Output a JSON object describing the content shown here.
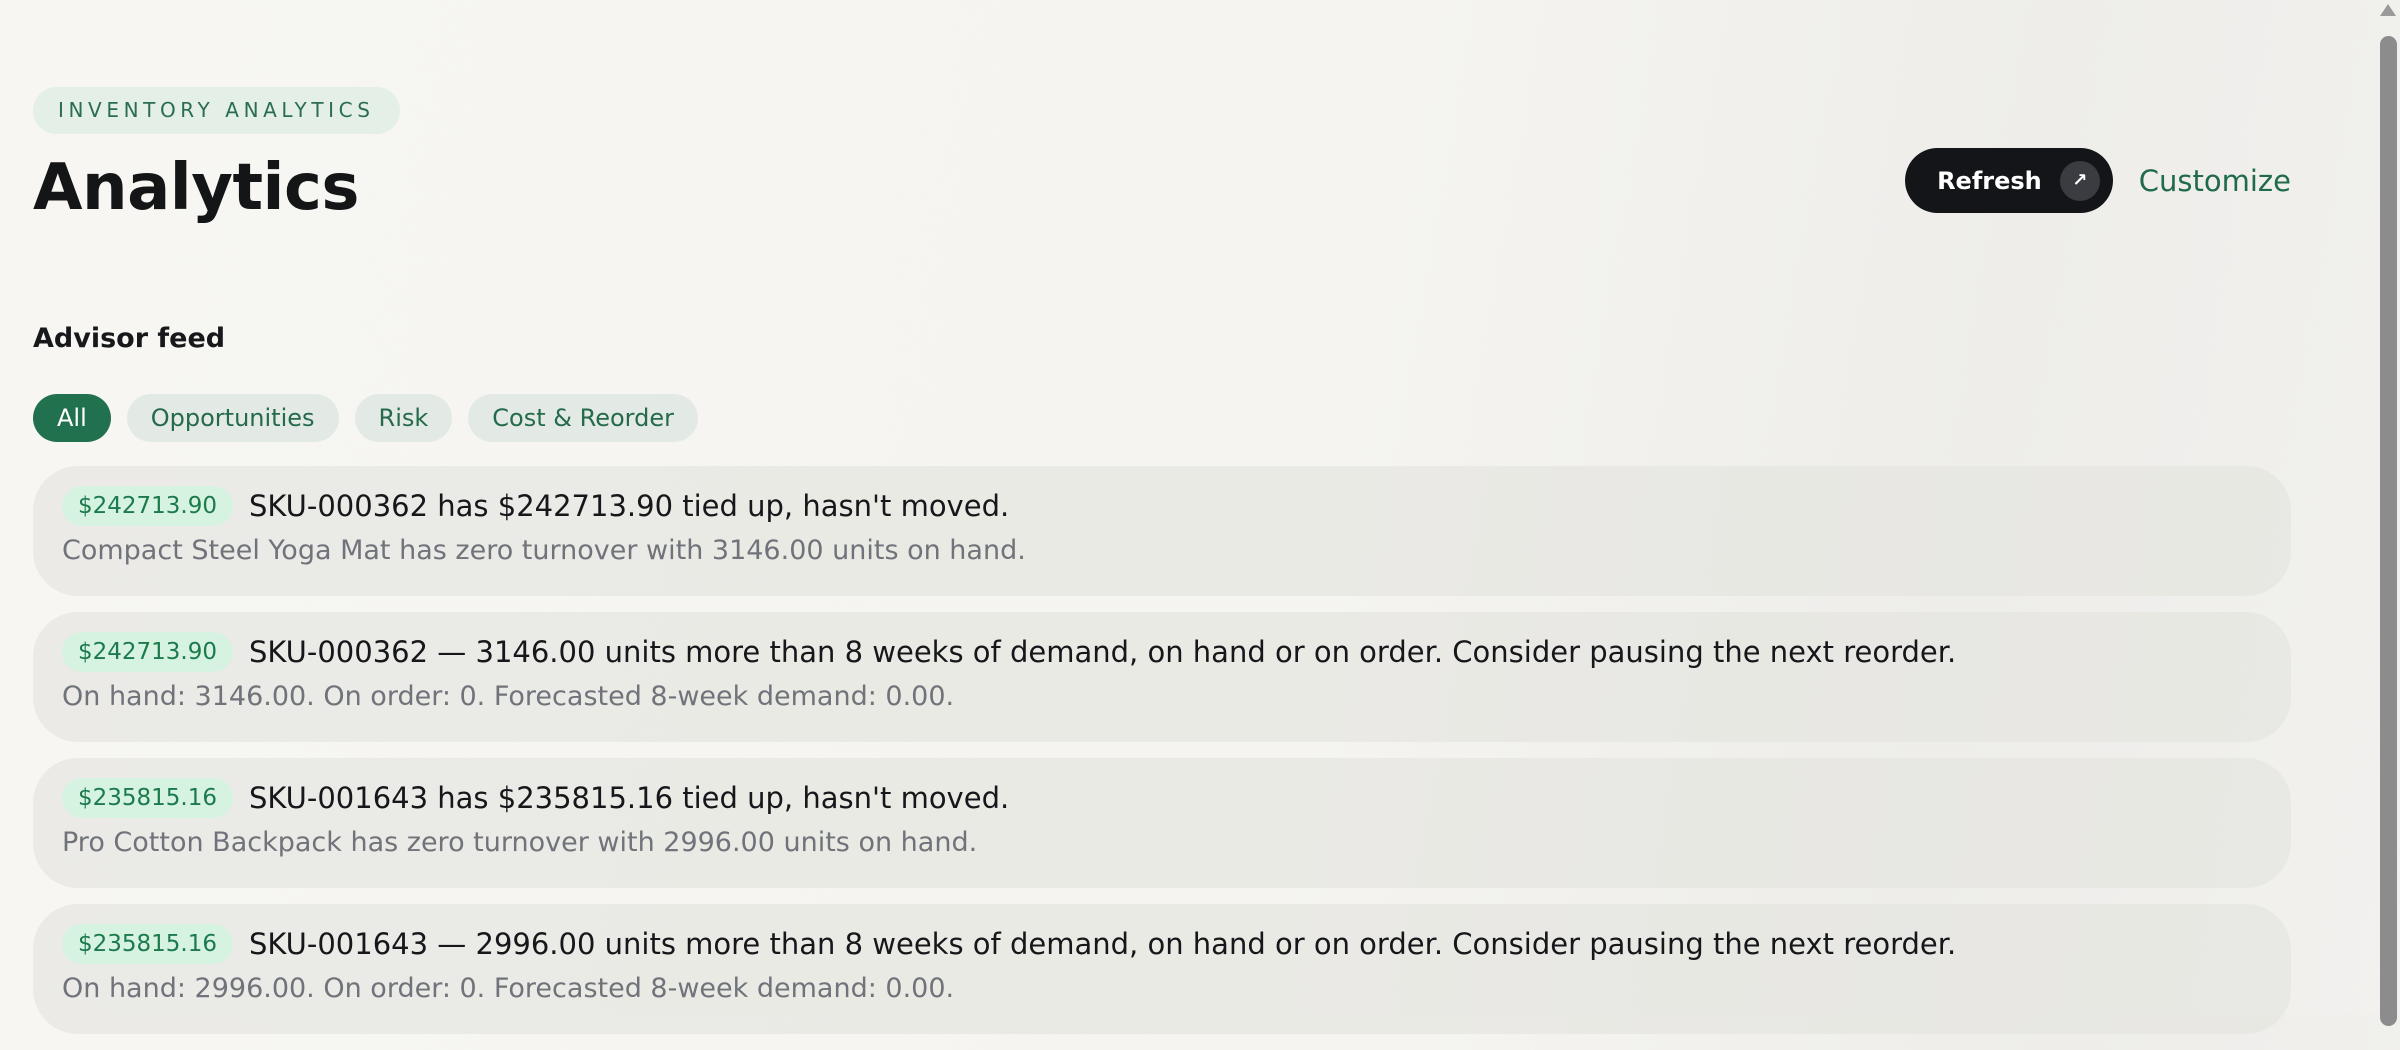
{
  "header": {
    "eyebrow": "INVENTORY ANALYTICS",
    "title": "Analytics",
    "refresh_label": "Refresh",
    "refresh_icon": "↗",
    "customize_label": "Customize"
  },
  "advisor": {
    "section_title": "Advisor feed",
    "filters": [
      {
        "label": "All",
        "active": true
      },
      {
        "label": "Opportunities",
        "active": false
      },
      {
        "label": "Risk",
        "active": false
      },
      {
        "label": "Cost & Reorder",
        "active": false
      }
    ],
    "items": [
      {
        "amount": "$242713.90",
        "title": "SKU-000362 has $242713.90 tied up, hasn't moved.",
        "detail": "Compact Steel Yoga Mat has zero turnover with 3146.00 units on hand."
      },
      {
        "amount": "$242713.90",
        "title": "SKU-000362 — 3146.00 units more than 8 weeks of demand, on hand or on order. Consider pausing the next reorder.",
        "detail": "On hand: 3146.00. On order: 0. Forecasted 8-week demand: 0.00."
      },
      {
        "amount": "$235815.16",
        "title": "SKU-001643 has $235815.16 tied up, hasn't moved.",
        "detail": "Pro Cotton Backpack has zero turnover with 2996.00 units on hand."
      },
      {
        "amount": "$235815.16",
        "title": "SKU-001643 — 2996.00 units more than 8 weeks of demand, on hand or on order. Consider pausing the next reorder.",
        "detail": "On hand: 2996.00. On order: 0. Forecasted 8-week demand: 0.00."
      }
    ]
  },
  "colors": {
    "accent": "#21704e",
    "badge_bg": "#d6f3e1",
    "dark_button": "#141518"
  }
}
